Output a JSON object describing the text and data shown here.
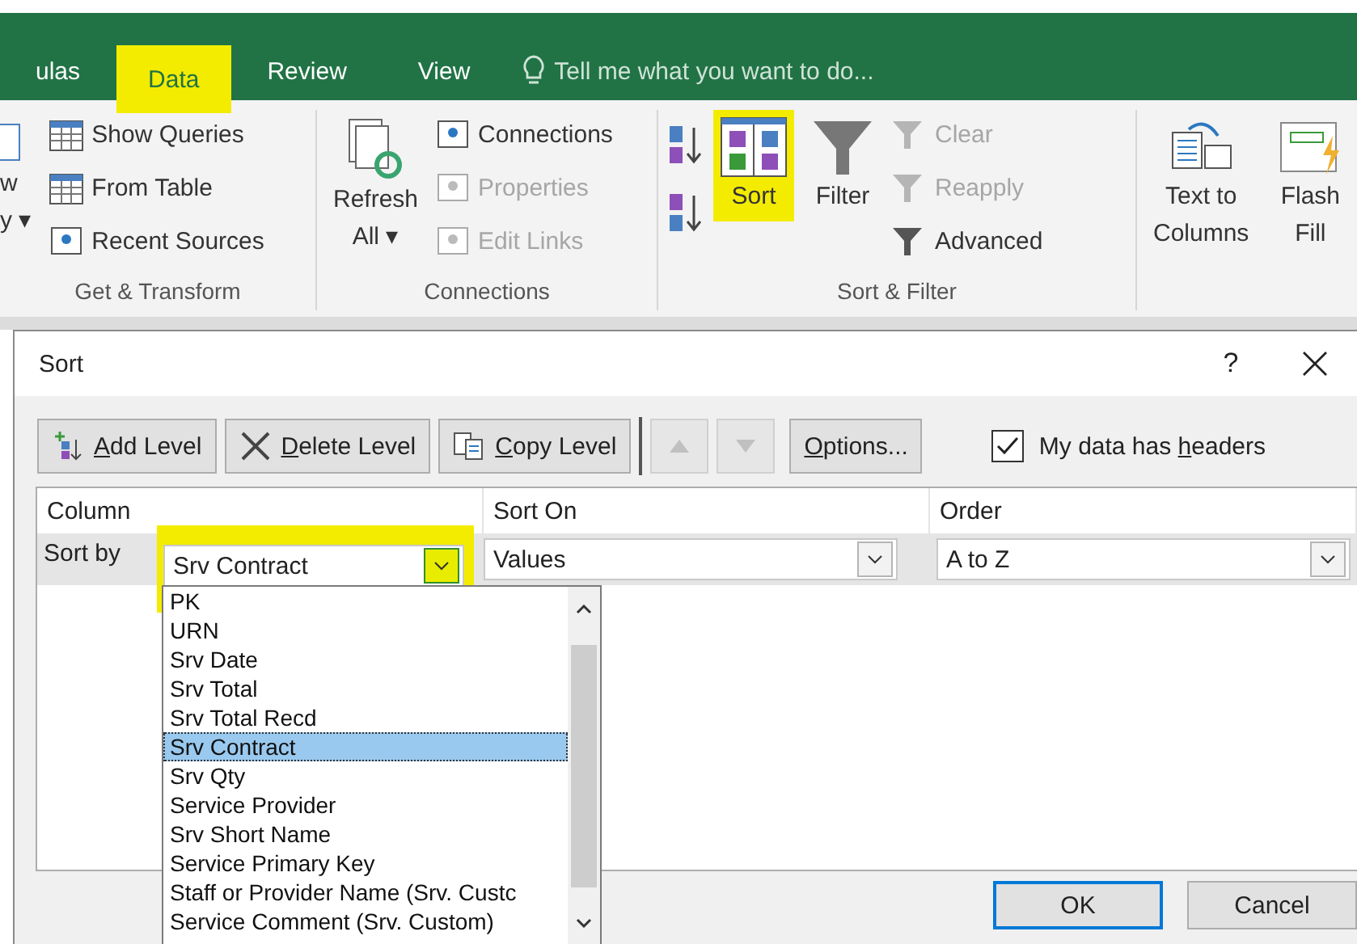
{
  "ribbon_tabs": [
    {
      "label": "ulas",
      "selected": false,
      "highlighted": false
    },
    {
      "label": "Data",
      "selected": true,
      "highlighted": true
    },
    {
      "label": "Review",
      "selected": false,
      "highlighted": false
    },
    {
      "label": "View",
      "selected": false,
      "highlighted": false
    }
  ],
  "tell_me": "Tell me what you want to do...",
  "get_transform": {
    "partial_button": [
      "w",
      "y"
    ],
    "caret": "▾",
    "items": [
      {
        "label": "Show Queries",
        "disabled": false
      },
      {
        "label": "From Table",
        "disabled": false
      },
      {
        "label": "Recent Sources",
        "disabled": false
      }
    ],
    "group_label": "Get & Transform"
  },
  "connections": {
    "refresh": [
      "Refresh",
      "All"
    ],
    "caret": "▾",
    "items": [
      {
        "label": "Connections",
        "disabled": false
      },
      {
        "label": "Properties",
        "disabled": true
      },
      {
        "label": "Edit Links",
        "disabled": true
      }
    ],
    "group_label": "Connections"
  },
  "sort_filter": {
    "sort": {
      "label": "Sort",
      "highlighted": true
    },
    "filter": "Filter",
    "items": [
      {
        "label": "Clear",
        "disabled": true
      },
      {
        "label": "Reapply",
        "disabled": true
      },
      {
        "label": "Advanced",
        "disabled": false
      }
    ],
    "group_label": "Sort & Filter"
  },
  "data_tools": [
    [
      "Text to",
      "Columns"
    ],
    [
      "Flash",
      "Fill"
    ]
  ],
  "dialog": {
    "title": "Sort",
    "help": "?",
    "toolbar": [
      {
        "label": {
          "key": "A",
          "after": "dd Level"
        }
      },
      {
        "label": {
          "key": "D",
          "after": "elete Level"
        }
      },
      {
        "label": {
          "key": "C",
          "after": "opy Level"
        }
      }
    ],
    "move_buttons": [
      {
        "disabled": true
      },
      {
        "disabled": true
      }
    ],
    "options": {
      "key": "O",
      "after": "ptions..."
    },
    "headers_checkbox": {
      "label": {
        "before": "My data has ",
        "key": "h",
        "after": "eaders"
      },
      "checked": true
    },
    "columns": [
      "Column",
      "Sort On",
      "Order"
    ],
    "rows": [
      {
        "label": "Sort by",
        "column": "Srv Contract",
        "sort_on": "Values",
        "order": "A to Z",
        "highlighted": true
      }
    ],
    "dropdown": [
      {
        "label": "PK",
        "selected": false
      },
      {
        "label": "URN",
        "selected": false
      },
      {
        "label": "Srv Date",
        "selected": false
      },
      {
        "label": "Srv Total",
        "selected": false
      },
      {
        "label": "Srv Total Recd",
        "selected": false
      },
      {
        "label": "Srv Contract",
        "selected": true
      },
      {
        "label": "Srv Qty",
        "selected": false
      },
      {
        "label": "Service Provider",
        "selected": false
      },
      {
        "label": "Srv Short Name",
        "selected": false
      },
      {
        "label": "Service Primary Key",
        "selected": false
      },
      {
        "label": "Staff or Provider Name (Srv. Custc",
        "selected": false
      },
      {
        "label": "Service Comment (Srv. Custom)",
        "selected": false
      }
    ],
    "buttons": [
      {
        "label": "OK",
        "default": true
      },
      {
        "label": "Cancel",
        "default": false
      }
    ]
  }
}
